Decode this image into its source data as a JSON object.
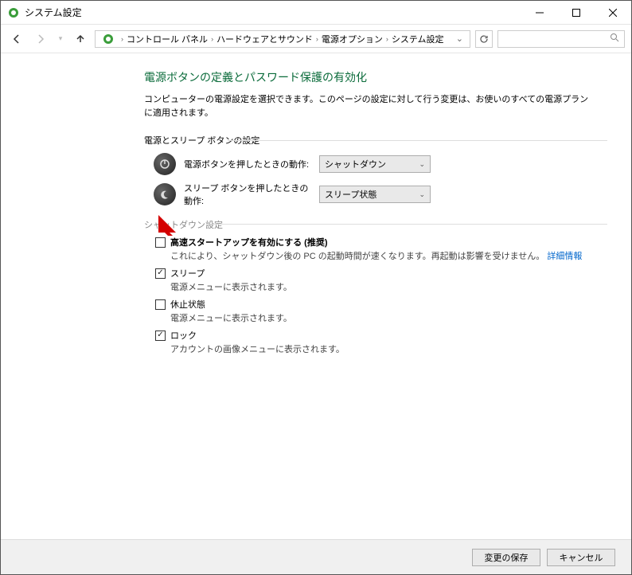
{
  "window": {
    "title": "システム設定"
  },
  "breadcrumb": {
    "items": [
      "コントロール パネル",
      "ハードウェアとサウンド",
      "電源オプション",
      "システム設定"
    ]
  },
  "search": {
    "placeholder": ""
  },
  "main": {
    "heading": "電源ボタンの定義とパスワード保護の有効化",
    "description": "コンピューターの電源設定を選択できます。このページの設定に対して行う変更は、お使いのすべての電源プランに適用されます。",
    "group1_label": "電源とスリープ ボタンの設定",
    "power_button": {
      "label": "電源ボタンを押したときの動作:",
      "value": "シャットダウン"
    },
    "sleep_button": {
      "label": "スリープ ボタンを押したときの動作:",
      "value": "スリープ状態"
    },
    "shutdown_label": "シャットダウン設定",
    "fast_startup": {
      "title": "高速スタートアップを有効にする (推奨)",
      "desc_prefix": "これにより、シャットダウン後の PC の起動時間が速くなります。再起動は影響を受けません。",
      "link": "詳細情報",
      "checked": false
    },
    "sleep": {
      "title": "スリープ",
      "desc": "電源メニューに表示されます。",
      "checked": true
    },
    "hibernate": {
      "title": "休止状態",
      "desc": "電源メニューに表示されます。",
      "checked": false
    },
    "lock": {
      "title": "ロック",
      "desc": "アカウントの画像メニューに表示されます。",
      "checked": true
    }
  },
  "footer": {
    "save": "変更の保存",
    "cancel": "キャンセル"
  }
}
